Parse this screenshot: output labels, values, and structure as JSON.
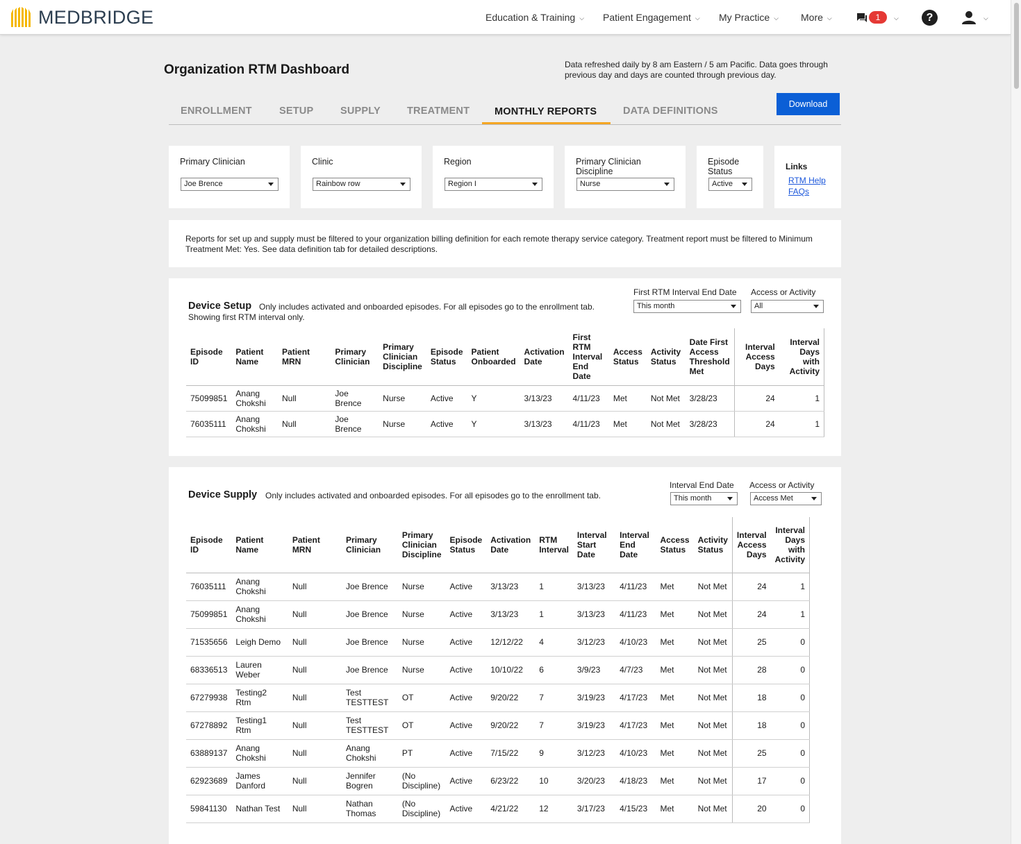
{
  "nav": {
    "brand": "MEDBRIDGE",
    "items": [
      "Education & Training",
      "Patient Engagement",
      "My Practice",
      "More"
    ],
    "message_count": "1",
    "help_glyph": "?",
    "colors": {
      "badge": "#e53935",
      "logo": "#f5b800",
      "brand_text": "#2c3e50"
    }
  },
  "header": {
    "title": "Organization RTM Dashboard",
    "refresh_note": "Data refreshed daily by 8 am Eastern / 5 am Pacific. Data goes through previous day and days are counted through previous day."
  },
  "tabs": {
    "items": [
      "ENROLLMENT",
      "SETUP",
      "SUPPLY",
      "TREATMENT",
      "MONTHLY REPORTS",
      "DATA DEFINITIONS"
    ],
    "active": "MONTHLY REPORTS",
    "accent_color": "#f5a623"
  },
  "download_label": "Download",
  "filters": {
    "primary_clinician": {
      "label": "Primary Clinician",
      "value": "Joe Brence"
    },
    "clinic": {
      "label": "Clinic",
      "value": "Rainbow row"
    },
    "region": {
      "label": "Region",
      "value": "Region I"
    },
    "discipline": {
      "label": "Primary Clinician Discipline",
      "value": "Nurse"
    },
    "episode_status": {
      "label": "Episode Status",
      "value": "Active"
    },
    "links": {
      "title": "Links",
      "rtm_help": "RTM Help",
      "faqs": "FAQs"
    }
  },
  "notice": "Reports for set up and supply must be filtered to your organization billing definition for each remote therapy service category. Treatment report must be filtered to Minimum Treatment Met: Yes. See data definition tab for detailed descriptions.",
  "device_setup": {
    "title": "Device Setup",
    "desc_line1": "Only includes activated and onboarded episodes. For all episodes go to the enrollment tab.",
    "desc_line2": "Showing first RTM interval only.",
    "interval_filter": {
      "label": "First RTM Interval End Date",
      "value": "This month"
    },
    "access_filter": {
      "label": "Access or Activity",
      "value": "All"
    },
    "columns": [
      "Episode ID",
      "Patient Name",
      "Patient MRN",
      "Primary Clinician",
      "Primary Clinician Discipline",
      "Episode Status",
      "Patient Onboarded",
      "Activation Date",
      "First RTM Interval End Date",
      "Access Status",
      "Activity Status",
      "Date First Access Threshold Met",
      "Interval Access Days",
      "Interval Days with Activity"
    ],
    "rows": [
      [
        "75099851",
        "Anang Chokshi",
        "Null",
        "Joe Brence",
        "Nurse",
        "Active",
        "Y",
        "3/13/23",
        "4/11/23",
        "Met",
        "Not Met",
        "3/28/23",
        "24",
        "1"
      ],
      [
        "76035111",
        "Anang Chokshi",
        "Null",
        "Joe Brence",
        "Nurse",
        "Active",
        "Y",
        "3/13/23",
        "4/11/23",
        "Met",
        "Not Met",
        "3/28/23",
        "24",
        "1"
      ]
    ]
  },
  "device_supply": {
    "title": "Device Supply",
    "desc": "Only includes activated and onboarded episodes. For all episodes go to the enrollment tab.",
    "interval_filter": {
      "label": "Interval End Date",
      "value": "This month"
    },
    "access_filter": {
      "label": "Access or Activity",
      "value": "Access Met"
    },
    "columns": [
      "Episode ID",
      "Patient Name",
      "Patient MRN",
      "Primary Clinician",
      "Primary Clinician Discipline",
      "Episode Status",
      "Activation Date",
      "RTM Interval",
      "Interval Start Date",
      "Interval End Date",
      "Access Status",
      "Activity Status",
      "Interval Access Days",
      "Interval Days with Activity"
    ],
    "rows": [
      [
        "76035111",
        "Anang Chokshi",
        "Null",
        "Joe Brence",
        "Nurse",
        "Active",
        "3/13/23",
        "1",
        "3/13/23",
        "4/11/23",
        "Met",
        "Not Met",
        "24",
        "1"
      ],
      [
        "75099851",
        "Anang Chokshi",
        "Null",
        "Joe Brence",
        "Nurse",
        "Active",
        "3/13/23",
        "1",
        "3/13/23",
        "4/11/23",
        "Met",
        "Not Met",
        "24",
        "1"
      ],
      [
        "71535656",
        "Leigh Demo",
        "Null",
        "Joe Brence",
        "Nurse",
        "Active",
        "12/12/22",
        "4",
        "3/12/23",
        "4/10/23",
        "Met",
        "Not Met",
        "25",
        "0"
      ],
      [
        "68336513",
        "Lauren Weber",
        "Null",
        "Joe Brence",
        "Nurse",
        "Active",
        "10/10/22",
        "6",
        "3/9/23",
        "4/7/23",
        "Met",
        "Not Met",
        "28",
        "0"
      ],
      [
        "67279938",
        "Testing2 Rtm",
        "Null",
        "Test TESTTEST",
        "OT",
        "Active",
        "9/20/22",
        "7",
        "3/19/23",
        "4/17/23",
        "Met",
        "Not Met",
        "18",
        "0"
      ],
      [
        "67278892",
        "Testing1 Rtm",
        "Null",
        "Test TESTTEST",
        "OT",
        "Active",
        "9/20/22",
        "7",
        "3/19/23",
        "4/17/23",
        "Met",
        "Not Met",
        "18",
        "0"
      ],
      [
        "63889137",
        "Anang Chokshi",
        "Null",
        "Anang Chokshi",
        "PT",
        "Active",
        "7/15/22",
        "9",
        "3/12/23",
        "4/10/23",
        "Met",
        "Not Met",
        "25",
        "0"
      ],
      [
        "62923689",
        "James Danford",
        "Null",
        "Jennifer Bogren",
        "(No Discipline)",
        "Active",
        "6/23/22",
        "10",
        "3/20/23",
        "4/18/23",
        "Met",
        "Not Met",
        "17",
        "0"
      ],
      [
        "59841130",
        "Nathan Test",
        "Null",
        "Nathan Thomas",
        "(No Discipline)",
        "Active",
        "4/21/22",
        "12",
        "3/17/23",
        "4/15/23",
        "Met",
        "Not Met",
        "20",
        "0"
      ]
    ]
  }
}
